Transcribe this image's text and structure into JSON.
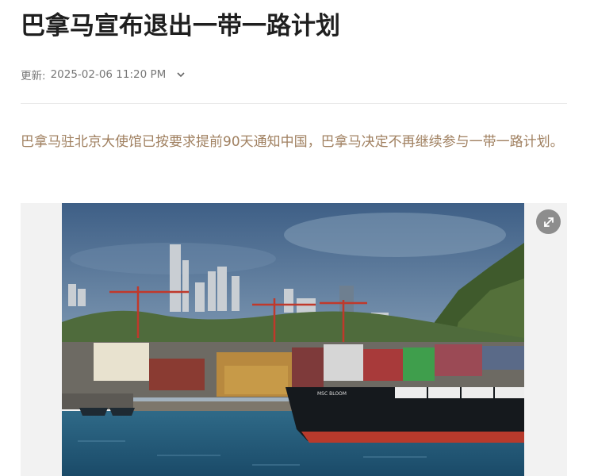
{
  "article": {
    "title": "巴拿马宣布退出一带一路计划",
    "updated_label": "更新:",
    "updated_time": "2025-02-06 11:20 PM",
    "lede": "巴拿马驻北京大使馆已按要求提前90天通知中国，巴拿马决定不再继续参与一带一路计划。"
  },
  "photo": {
    "ship_name": "MSC BLOOM"
  },
  "icons": {
    "meta_toggle": "chevron-down-icon",
    "expand": "expand-icon"
  },
  "colors": {
    "lede_text": "#a08060",
    "title_text": "#1f1f1f"
  }
}
